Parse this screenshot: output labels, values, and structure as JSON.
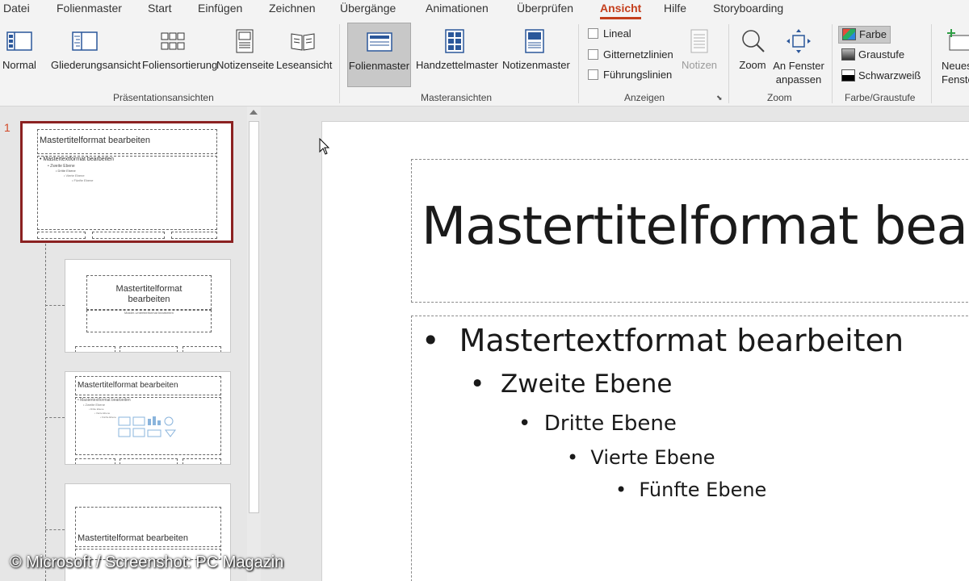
{
  "menu": {
    "tabs": [
      {
        "label": "Datei"
      },
      {
        "label": "Folienmaster"
      },
      {
        "label": "Start"
      },
      {
        "label": "Einfügen"
      },
      {
        "label": "Zeichnen"
      },
      {
        "label": "Übergänge"
      },
      {
        "label": "Animationen"
      },
      {
        "label": "Überprüfen"
      },
      {
        "label": "Ansicht",
        "active": true
      },
      {
        "label": "Hilfe"
      },
      {
        "label": "Storyboarding"
      }
    ]
  },
  "ribbon": {
    "presentation_views": {
      "label": "Präsentationsansichten",
      "buttons": [
        "Normal",
        "Gliederungsansicht",
        "Foliensortierung",
        "Notizenseite",
        "Leseansicht"
      ]
    },
    "master_views": {
      "label": "Masteransichten",
      "buttons": [
        "Folienmaster",
        "Handzettelmaster",
        "Notizenmaster"
      ],
      "selected": "Folienmaster"
    },
    "show": {
      "label": "Anzeigen",
      "checkboxes": [
        "Lineal",
        "Gitternetzlinien",
        "Führungslinien"
      ],
      "notes_button": "Notizen"
    },
    "zoom": {
      "label": "Zoom",
      "zoom_button": "Zoom",
      "fit_line1": "An Fenster",
      "fit_line2": "anpassen"
    },
    "color": {
      "label": "Farbe/Graustufe",
      "options": [
        "Farbe",
        "Graustufe",
        "Schwarzweiß"
      ],
      "selected": "Farbe"
    },
    "window": {
      "line1": "Neues",
      "line2": "Fenster"
    }
  },
  "thumbnails": {
    "selected_number": "1",
    "master_title": "Mastertitelformat bearbeiten",
    "master_text": "Mastertextformat bearbeiten",
    "levels": [
      "Zweite Ebene",
      "Dritte Ebene",
      "Vierte Ebene",
      "Fünfte Ebene"
    ],
    "layout1_title_line1": "Mastertitelformat",
    "layout1_title_line2": "bearbeiten",
    "layout1_subtitle": "Master-Untertitelformat bearbeiten",
    "layout2_title": "Mastertitelformat bearbeiten",
    "layout3_title": "Mastertitelformat bearbeiten"
  },
  "slide": {
    "title": "Mastertitelformat bearbeiten",
    "bullets": [
      {
        "text": "Mastertextformat bearbeiten",
        "level": 1
      },
      {
        "text": "Zweite Ebene",
        "level": 2
      },
      {
        "text": "Dritte Ebene",
        "level": 3
      },
      {
        "text": "Vierte Ebene",
        "level": 4
      },
      {
        "text": "Fünfte Ebene",
        "level": 5
      }
    ]
  },
  "colors": {
    "accent": "#c43e1c",
    "selection_border": "#8b2121"
  },
  "watermark": "© Microsoft / Screenshot: PC Magazin"
}
